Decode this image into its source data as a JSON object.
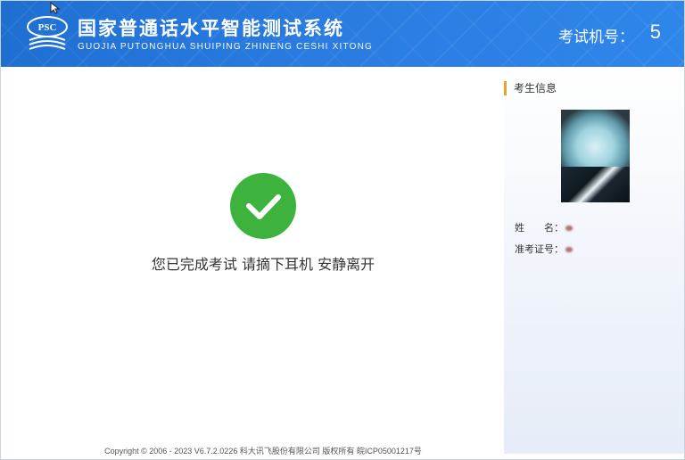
{
  "header": {
    "logo_text": "PSC",
    "title_cn": "国家普通话水平智能测试系统",
    "title_en": "GUOJIA PUTONGHUA SHUIPING ZHINENG CESHI XITONG",
    "machine_label": "考试机号：",
    "machine_number": "5"
  },
  "main": {
    "completion_message": "您已完成考试 请摘下耳机 安静离开",
    "footer": "Copyright © 2006 - 2023 V6.7.2.0226 科大讯飞股份有限公司 版权所有 皖ICP05001217号"
  },
  "side": {
    "title": "考生信息",
    "name_label": "姓　　名：",
    "ticket_label": "准考证号："
  },
  "colors": {
    "header_bg": "#2a7be0",
    "check_green": "#3db33d",
    "accent_orange": "#f0a030"
  },
  "icons": {
    "logo": "psc-logo-icon",
    "success": "check-circle-icon"
  }
}
